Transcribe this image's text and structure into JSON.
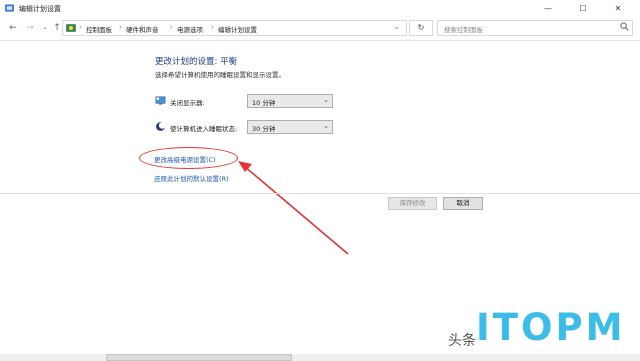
{
  "window": {
    "title": "编辑计划设置",
    "minimize": "—",
    "maximize": "☐",
    "close": "✕"
  },
  "nav": {
    "breadcrumbs": [
      "控制面板",
      "硬件和声音",
      "电源选项",
      "编辑计划设置"
    ],
    "separator": "›",
    "search_placeholder": "搜索控制面板"
  },
  "main": {
    "heading": "更改计划的设置: 平衡",
    "subtext": "选择希望计算机使用的睡眠设置和显示设置。",
    "display_off": {
      "label": "关闭显示器:",
      "value": "10 分钟"
    },
    "sleep": {
      "label": "使计算机进入睡眠状态:",
      "value": "30 分钟"
    },
    "advanced_link": "更改高级电源设置(C)",
    "restore_link": "还原此计划的默认设置(R)",
    "save_button": "保存修改",
    "cancel_button": "取消"
  },
  "watermark": {
    "small": "头条",
    "big": "ITOPM"
  },
  "colors": {
    "link": "#1a56b6",
    "heading": "#1e3a8a",
    "annotation": "#e53333",
    "watermark": "#3cbde8"
  }
}
